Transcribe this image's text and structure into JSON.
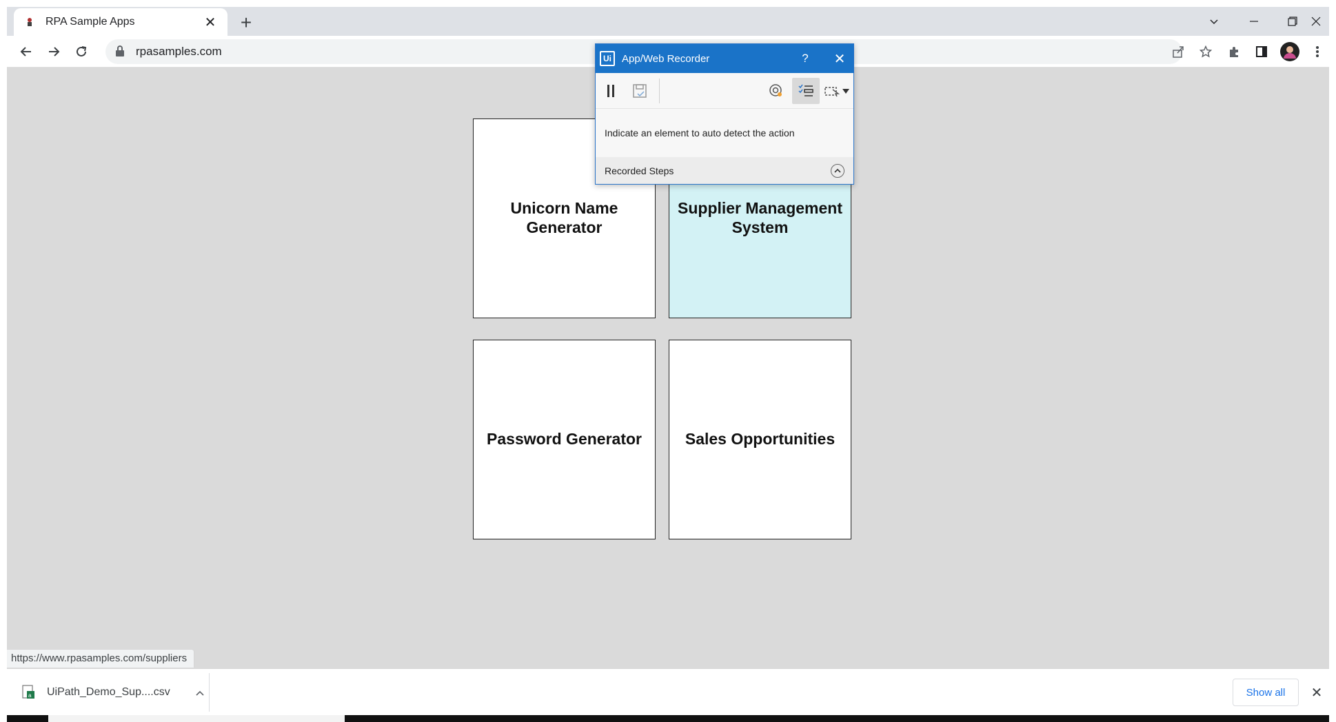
{
  "browser": {
    "tab_title": "RPA Sample Apps",
    "address": "rpasamples.com",
    "status_url": "https://www.rpasamples.com/suppliers"
  },
  "cards": [
    {
      "label": "Unicorn Name Generator"
    },
    {
      "label": "Supplier Management System"
    },
    {
      "label": "Password Generator"
    },
    {
      "label": "Sales Opportunities"
    }
  ],
  "recorder": {
    "title": "App/Web Recorder",
    "help": "?",
    "hint": "Indicate an element to auto detect the action",
    "steps_label": "Recorded Steps"
  },
  "downloads": {
    "file_name": "UiPath_Demo_Sup....csv",
    "show_all": "Show all"
  },
  "colors": {
    "recorder_title_bg": "#1a73c8",
    "highlight_card": "#d3f2f5",
    "page_bg": "#dadada"
  }
}
